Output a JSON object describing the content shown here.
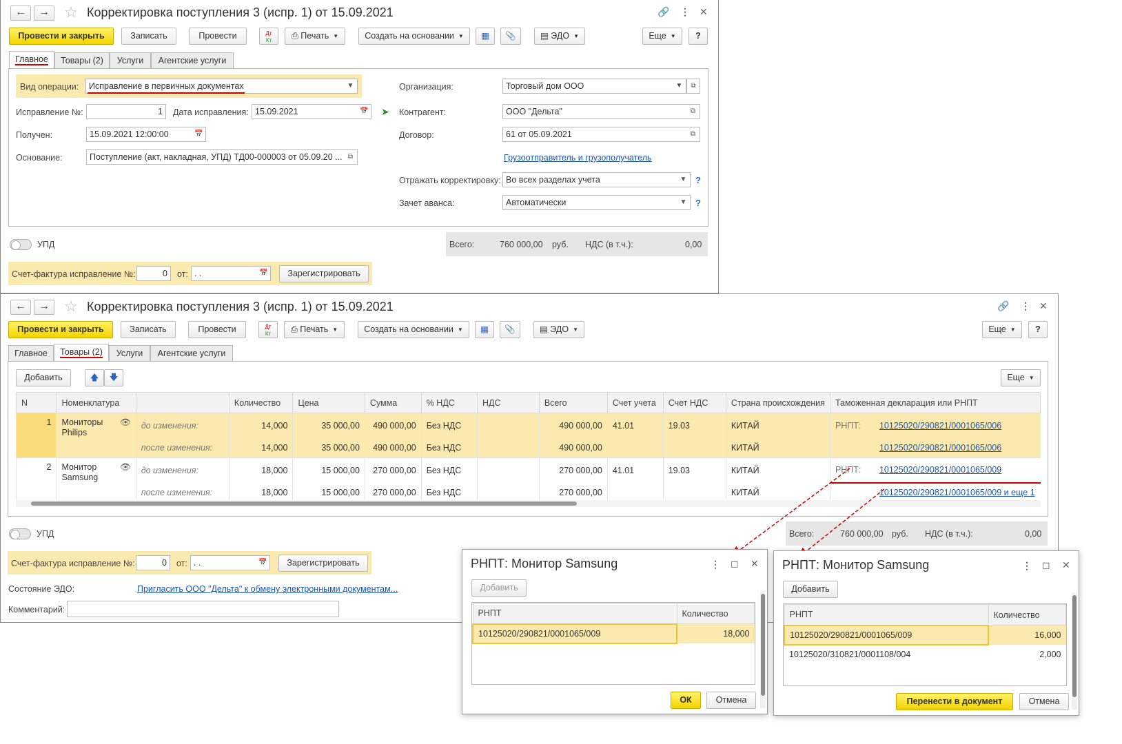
{
  "doc_title": "Корректировка поступления 3 (испр. 1) от 15.09.2021",
  "toolbar": {
    "post_close": "Провести и закрыть",
    "save": "Записать",
    "post": "Провести",
    "dt_top": "Дт",
    "dt_bottom": "Кт",
    "print": "Печать",
    "create_basis": "Создать на основании",
    "edo": "ЭДО",
    "more": "Еще",
    "help": "?"
  },
  "tabs": [
    "Главное",
    "Товары (2)",
    "Услуги",
    "Агентские услуги"
  ],
  "main": {
    "op_type_label": "Вид операции:",
    "op_type_value": "Исправление в первичных документах",
    "corr_no_label": "Исправление №:",
    "corr_no_value": "1",
    "corr_date_label": "Дата исправления:",
    "corr_date_value": "15.09.2021",
    "received_label": "Получен:",
    "received_value": "15.09.2021 12:00:00",
    "basis_label": "Основание:",
    "basis_value": "Поступление (акт, накладная, УПД) ТД00-000003 от 05.09.20 ...",
    "org_label": "Организация:",
    "org_value": "Торговый дом ООО",
    "contractor_label": "Контрагент:",
    "contractor_value": "ООО \"Дельта\"",
    "contract_label": "Договор:",
    "contract_value": "61 от 05.09.2021",
    "shipper_link": "Грузоотправитель и грузополучатель",
    "reflect_label": "Отражать корректировку:",
    "reflect_value": "Во всех разделах учета",
    "advance_label": "Зачет аванса:",
    "advance_value": "Автоматически"
  },
  "footer": {
    "upd_label": "УПД",
    "total_label": "Всего:",
    "total_value": "760 000,00",
    "currency": "руб.",
    "vat_label": "НДС (в т.ч.):",
    "vat_value": "0,00",
    "invoice_label": "Счет-фактура исправление №:",
    "invoice_no": "0",
    "invoice_from_label": "от:",
    "invoice_date": " .  .",
    "register_btn": "Зарегистрировать",
    "edo_state_label": "Состояние ЭДО:",
    "edo_state_link": "Пригласить ООО \"Дельта\" к обмену электронными документам...",
    "comment_label": "Комментарий:"
  },
  "goods": {
    "add_btn": "Добавить",
    "more": "Еще",
    "columns": [
      "N",
      "Номенклатура",
      "",
      "Количество",
      "Цена",
      "Сумма",
      "% НДС",
      "НДС",
      "Всего",
      "Счет учета",
      "Счет НДС",
      "Страна происхождения",
      "Таможенная декларация или РНПТ"
    ],
    "rows": [
      {
        "n": "1",
        "name1": "Мониторы",
        "name2": "Philips",
        "state": "до изменения:",
        "qty": "14,000",
        "price": "35 000,00",
        "sum": "490 000,00",
        "vat_rate": "Без НДС",
        "vat": "",
        "total": "490 000,00",
        "acc": "41.01",
        "vat_acc": "19.03",
        "country": "КИТАЙ",
        "rnpt_label": "РНПТ:",
        "rnpt": "10125020/290821/0001065/006"
      },
      {
        "n": "",
        "name1": "",
        "name2": "",
        "state": "после изменения:",
        "qty": "14,000",
        "price": "35 000,00",
        "sum": "490 000,00",
        "vat_rate": "Без НДС",
        "vat": "",
        "total": "490 000,00",
        "acc": "",
        "vat_acc": "",
        "country": "КИТАЙ",
        "rnpt_label": "",
        "rnpt": "10125020/290821/0001065/006"
      },
      {
        "n": "2",
        "name1": "Монитор",
        "name2": "Samsung",
        "state": "до изменения:",
        "qty": "18,000",
        "price": "15 000,00",
        "sum": "270 000,00",
        "vat_rate": "Без НДС",
        "vat": "",
        "total": "270 000,00",
        "acc": "41.01",
        "vat_acc": "19.03",
        "country": "КИТАЙ",
        "rnpt_label": "РНПТ:",
        "rnpt": "10125020/290821/0001065/009"
      },
      {
        "n": "",
        "name1": "",
        "name2": "",
        "state": "после изменения:",
        "qty": "18,000",
        "price": "15 000,00",
        "sum": "270 000,00",
        "vat_rate": "Без НДС",
        "vat": "",
        "total": "270 000,00",
        "acc": "",
        "vat_acc": "",
        "country": "КИТАЙ",
        "rnpt_label": "",
        "rnpt": "10125020/290821/0001065/009 и еще 1"
      }
    ]
  },
  "dialog1": {
    "title": "РНПТ: Монитор Samsung",
    "add_btn": "Добавить",
    "col1": "РНПТ",
    "col2": "Количество",
    "rows": [
      {
        "rnpt": "10125020/290821/0001065/009",
        "qty": "18,000"
      }
    ],
    "ok_btn": "ОК",
    "cancel_btn": "Отмена"
  },
  "dialog2": {
    "title": "РНПТ: Монитор Samsung",
    "add_btn": "Добавить",
    "col1": "РНПТ",
    "col2": "Количество",
    "rows": [
      {
        "rnpt": "10125020/290821/0001065/009",
        "qty": "16,000"
      },
      {
        "rnpt": "10125020/310821/0001108/004",
        "qty": "2,000"
      }
    ],
    "transfer_btn": "Перенести в документ",
    "cancel_btn": "Отмена"
  }
}
